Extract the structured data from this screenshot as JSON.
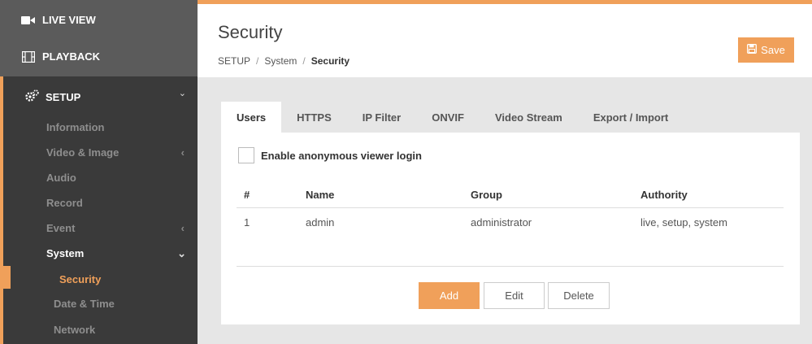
{
  "nav": {
    "live_view": "LIVE VIEW",
    "playback": "PLAYBACK",
    "setup": "SETUP",
    "setup_icon": "gears-icon",
    "live_icon": "video-camera-icon",
    "playback_icon": "film-icon"
  },
  "sidebar": {
    "items": [
      {
        "label": "Information",
        "has_chevron": false
      },
      {
        "label": "Video & Image",
        "has_chevron": true,
        "chevron": "‹"
      },
      {
        "label": "Audio",
        "has_chevron": false
      },
      {
        "label": "Record",
        "has_chevron": false
      },
      {
        "label": "Event",
        "has_chevron": true,
        "chevron": "‹"
      },
      {
        "label": "System",
        "has_chevron": true,
        "chevron": "⌄"
      }
    ],
    "system_sub": [
      {
        "label": "Security",
        "active": true
      },
      {
        "label": "Date & Time"
      },
      {
        "label": "Network"
      }
    ],
    "setup_chevron": "⌄"
  },
  "header": {
    "title": "Security",
    "breadcrumb": [
      "SETUP",
      "System",
      "Security"
    ],
    "breadcrumb_sep": "/",
    "save_label": "Save"
  },
  "tabs": [
    "Users",
    "HTTPS",
    "IP Filter",
    "ONVIF",
    "Video Stream",
    "Export / Import"
  ],
  "active_tab": "Users",
  "anonymous_login": {
    "label": "Enable anonymous viewer login",
    "checked": false
  },
  "users_table": {
    "headers": [
      "#",
      "Name",
      "Group",
      "Authority"
    ],
    "rows": [
      [
        "1",
        "admin",
        "administrator",
        "live, setup, system"
      ]
    ]
  },
  "actions": {
    "add": "Add",
    "edit": "Edit",
    "delete": "Delete"
  },
  "colors": {
    "accent": "#f0a05a",
    "sidebar_bg": "#3a3a3a",
    "topnav_bg": "#5b5b5b"
  }
}
